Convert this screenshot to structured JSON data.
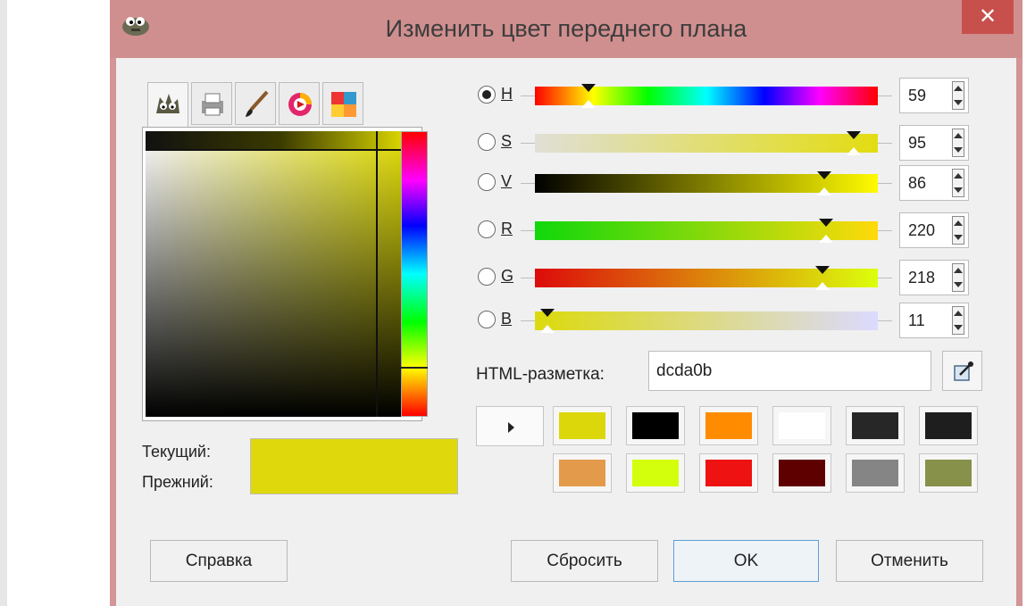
{
  "window": {
    "title": "Изменить цвет переднего плана",
    "close_label": "✕"
  },
  "tabs": [
    {
      "name": "gimp",
      "icon": "gimp-icon"
    },
    {
      "name": "cmyk",
      "icon": "printer-icon"
    },
    {
      "name": "watercolor",
      "icon": "brush-icon"
    },
    {
      "name": "wheel",
      "icon": "color-wheel-icon"
    },
    {
      "name": "scales",
      "icon": "palette-icon"
    }
  ],
  "current_label": "Текущий:",
  "old_label": "Прежний:",
  "current_color": "#dfd80c",
  "channels": [
    {
      "key": "H",
      "label": "H",
      "value": "59",
      "selected": true
    },
    {
      "key": "S",
      "label": "S",
      "value": "95",
      "selected": false
    },
    {
      "key": "V",
      "label": "V",
      "value": "86",
      "selected": false
    },
    {
      "key": "R",
      "label": "R",
      "value": "220",
      "selected": false
    },
    {
      "key": "G",
      "label": "G",
      "value": "218",
      "selected": false
    },
    {
      "key": "B",
      "label": "B",
      "value": "11",
      "selected": false
    }
  ],
  "html_label": "HTML-разметка:",
  "html_value": "dcda0b",
  "history_colors": [
    "#dcd70b",
    "#000000",
    "#ff8c00",
    "#ffffff",
    "#272727",
    "#1e1e1e",
    "#e39a4a",
    "#d4ff0c",
    "#ee1212",
    "#5e0000",
    "#858585",
    "#87914a"
  ],
  "buttons": {
    "help": "Справка",
    "reset": "Сбросить",
    "ok": "OK",
    "cancel": "Отменить"
  }
}
